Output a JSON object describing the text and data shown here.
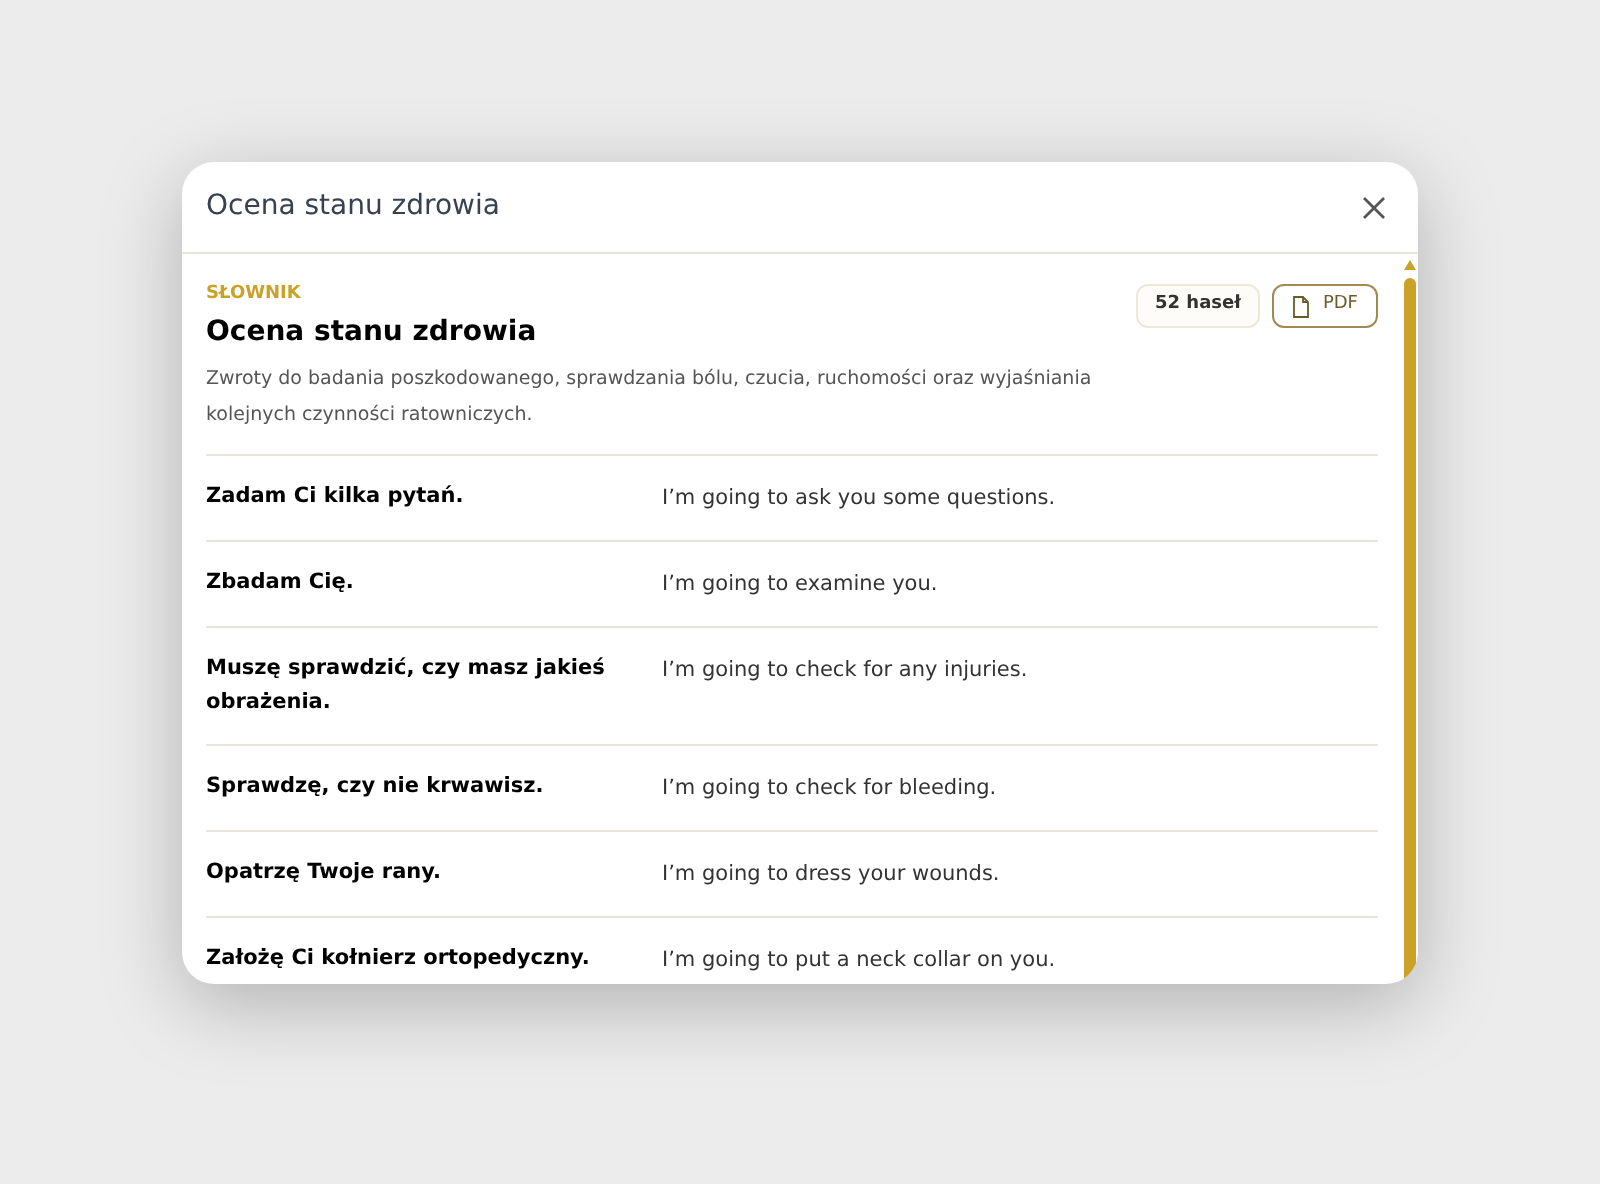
{
  "dialog": {
    "title": "Ocena stanu zdrowia"
  },
  "section": {
    "eyebrow": "SŁOWNIK",
    "title": "Ocena stanu zdrowia",
    "description": "Zwroty do badania poszkodowanego, sprawdzania bólu, czucia, ruchomości oraz wyjaśniania kolejnych czynności ratowniczych.",
    "count": "52 haseł",
    "pdf_label": "PDF"
  },
  "entries": [
    {
      "term": "Zadam Ci kilka pytań.",
      "translation": "I’m going to ask you some questions."
    },
    {
      "term": "Zbadam Cię.",
      "translation": "I’m going to examine you."
    },
    {
      "term": "Muszę sprawdzić, czy masz jakieś obrażenia.",
      "translation": "I’m going to check for any injuries."
    },
    {
      "term": "Sprawdzę, czy nie krwawisz.",
      "translation": "I’m going to check for bleeding."
    },
    {
      "term": "Opatrzę Twoje rany.",
      "translation": "I’m going to dress your wounds."
    },
    {
      "term": "Założę Ci kołnierz ortopedyczny.",
      "translation": "I’m going to put a neck collar on you."
    }
  ]
}
